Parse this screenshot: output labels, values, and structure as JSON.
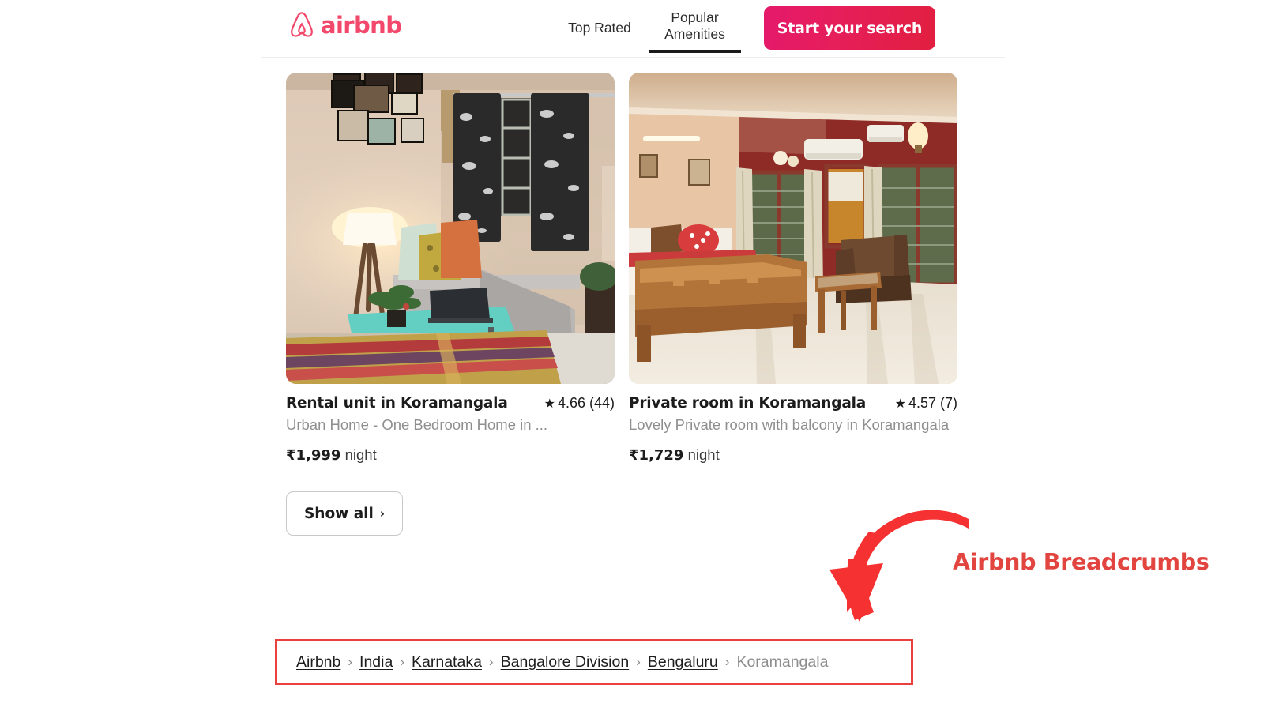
{
  "header": {
    "logo": {
      "icon": "airbnb-belo-icon",
      "wordmark": "airbnb",
      "color": "#f2486b"
    },
    "tabs": [
      {
        "label": "Top Rated",
        "active": false
      },
      {
        "label": "Popular\nAmenities",
        "line1": "Popular",
        "line2": "Amenities",
        "active": true
      }
    ],
    "cta": {
      "label": "Start your search",
      "gradient_from": "#e5196b",
      "gradient_to": "#e11f3f"
    }
  },
  "listings": [
    {
      "photo_alt": "living-room-photo",
      "title": "Rental unit in Koramangala",
      "rating_star": "★",
      "rating": "4.66 (44)",
      "subtitle": "Urban Home -  One Bedroom Home in ...",
      "price": "₹1,999",
      "price_unit": "night"
    },
    {
      "photo_alt": "bedroom-photo",
      "title": "Private room in Koramangala",
      "rating_star": "★",
      "rating": "4.57 (7)",
      "subtitle": "Lovely Private room with balcony in Koramangala",
      "price": "₹1,729",
      "price_unit": "night"
    }
  ],
  "show_all": {
    "label": "Show all",
    "chevron": "›"
  },
  "annotation": {
    "label": "Airbnb Breadcrumbs",
    "color": "#e2453f",
    "arrow": "curved-down-left-arrow"
  },
  "breadcrumb": {
    "separator": "›",
    "highlight_color": "#ec3f3f",
    "items": [
      {
        "label": "Airbnb",
        "current": false
      },
      {
        "label": "India",
        "current": false
      },
      {
        "label": "Karnataka",
        "current": false
      },
      {
        "label": "Bangalore Division",
        "current": false
      },
      {
        "label": "Bengaluru",
        "current": false
      },
      {
        "label": "Koramangala",
        "current": true
      }
    ]
  }
}
